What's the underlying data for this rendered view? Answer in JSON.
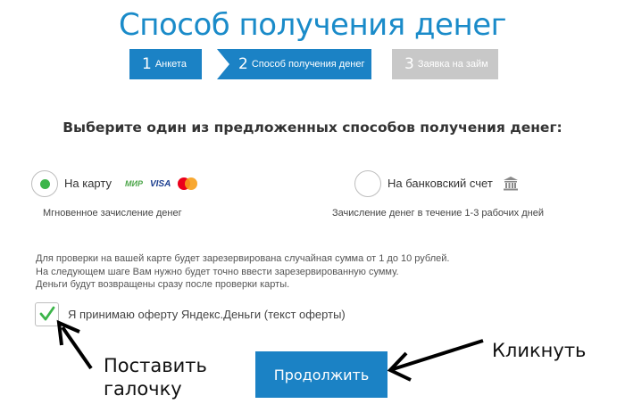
{
  "page": {
    "title": "Способ получения денег"
  },
  "steps": [
    {
      "num": "1",
      "label": "Анкета",
      "state": "done"
    },
    {
      "num": "2",
      "label": "Способ получения денег",
      "state": "active"
    },
    {
      "num": "3",
      "label": "Заявка на займ",
      "state": "inactive"
    }
  ],
  "heading": "Выберите один из предложенных способов получения денег:",
  "options": {
    "card": {
      "label": "На карту",
      "sublabel": "Мгновенное зачисление денег",
      "selected": true,
      "logos": {
        "mir": "МИР",
        "visa": "VISA"
      }
    },
    "bank": {
      "label": "На банковский счет",
      "sublabel": "Зачисление денег в течение 1-3 рабочих дней",
      "selected": false
    }
  },
  "info_lines": [
    "Для проверки на вашей карте будет зарезервирована случайная сумма от 1 до 10 рублей.",
    "На следующем шаге Вам нужно будет точно ввести зарезервированную сумму.",
    "Деньги будут возвращены сразу после проверки карты."
  ],
  "offer": {
    "label": "Я принимаю оферту Яндекс.Деньги (текст оферты)",
    "checked": true
  },
  "continue_label": "Продолжить",
  "annotations": {
    "check_line1": "Поставить",
    "check_line2": "галочку",
    "click": "Кликнуть"
  },
  "colors": {
    "primary": "#1b82c5",
    "title": "#1a8bc9",
    "inactive_step": "#c8c8c8",
    "radio_selected": "#3cb54a",
    "check": "#3cb54a"
  }
}
